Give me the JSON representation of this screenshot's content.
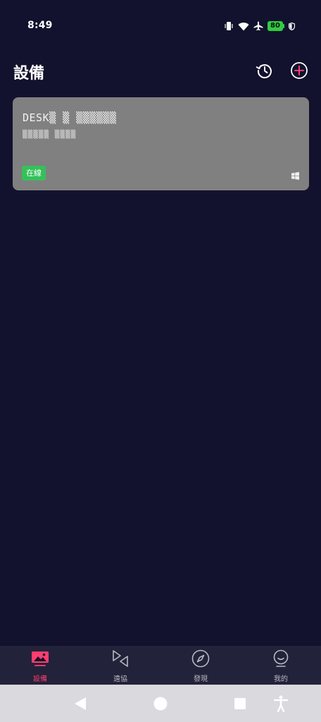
{
  "status_bar": {
    "time": "8:49",
    "battery_level": "80",
    "icons": [
      "vibrate-icon",
      "wifi-icon",
      "airplane-icon",
      "battery-icon",
      "shield-icon"
    ]
  },
  "header": {
    "title": "設備",
    "history_icon": "history-icon",
    "add_icon": "add-circle-icon"
  },
  "device": {
    "name": "DESK▒ ▒ ▒▒▒▒▒▒",
    "id": "▒▒▒▒▒ ▒▒▒▒",
    "status": "在線",
    "os_icon": "windows-icon",
    "status_color": "#35c05a"
  },
  "nav": {
    "items": [
      {
        "label": "設備",
        "icon": "devices-icon",
        "active": true
      },
      {
        "label": "遠協",
        "icon": "remote-icon",
        "active": false
      },
      {
        "label": "發現",
        "icon": "compass-icon",
        "active": false
      },
      {
        "label": "我的",
        "icon": "profile-icon",
        "active": false
      }
    ],
    "active_color": "#ff3d6e"
  },
  "colors": {
    "background": "#12122e",
    "card": "#808080",
    "accent": "#ff3d6e"
  }
}
